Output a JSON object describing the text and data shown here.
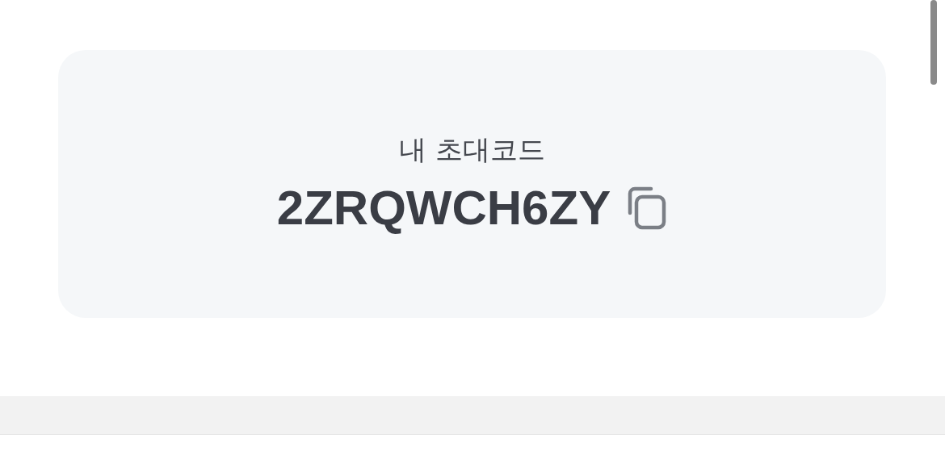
{
  "invite_card": {
    "label": "내 초대코드",
    "code": "2ZRQWCH6ZY"
  }
}
